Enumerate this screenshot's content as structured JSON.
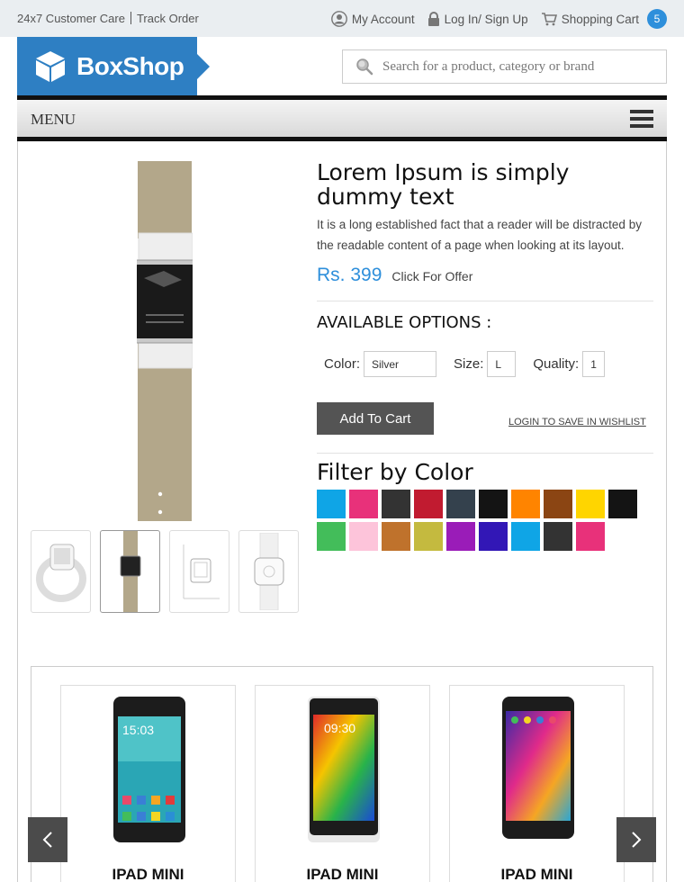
{
  "topbar": {
    "customer_care": "24x7 Customer Care",
    "track_order": "Track Order",
    "my_account": "My Account",
    "login_signup": "Log In/ Sign Up",
    "shopping_cart": "Shopping Cart",
    "cart_count": "5"
  },
  "header": {
    "logo_text": "BoxShop",
    "search_placeholder": "Search for a product, category or brand",
    "menu_label": "MENU"
  },
  "product": {
    "title": "Lorem Ipsum is simply dummy text",
    "description": "It is a long established fact that a reader will be distracted by the readable content of a page when looking at its layout.",
    "price": "Rs. 399",
    "offer_text": "Click For Offer",
    "options_title": "AVAILABLE OPTIONS :",
    "color_label": "Color:",
    "color_value": "Silver",
    "size_label": "Size:",
    "size_value": "L",
    "quantity_label": "Quality:",
    "quantity_value": "1",
    "add_to_cart": "Add To Cart",
    "wishlist": "LOGIN TO SAVE IN WISHLIST"
  },
  "filter": {
    "title": "Filter by Color",
    "colors": [
      "#0fa5e6",
      "#e8317a",
      "#333333",
      "#c11b30",
      "#34414d",
      "#141414",
      "#ff8400",
      "#8b4513",
      "#ffd500",
      "#141414",
      "#43bd5a",
      "#fdc4da",
      "#bf722c",
      "#c4ba3f",
      "#9a1cb8",
      "#3217b6",
      "#0fa5e6",
      "#333333",
      "#e8317a"
    ]
  },
  "carousel": {
    "products": [
      {
        "name": "IPAD MINI"
      },
      {
        "name": "IPAD MINI"
      },
      {
        "name": "IPAD MINI"
      }
    ]
  }
}
